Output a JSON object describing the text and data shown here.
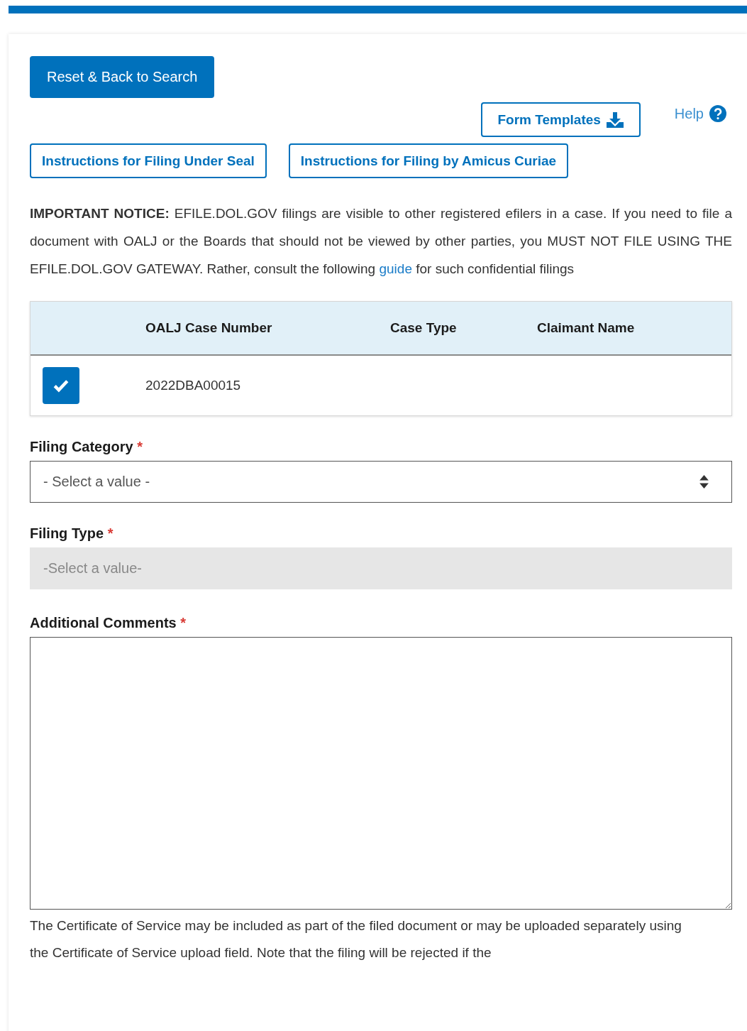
{
  "header_buttons": {
    "reset": "Reset & Back to Search",
    "form_templates": "Form Templates",
    "help": "Help"
  },
  "instruction_buttons": [
    "Instructions for Filing Under Seal",
    "Instructions for Filing by Amicus Curiae"
  ],
  "notice": {
    "label": "IMPORTANT NOTICE:",
    "text_before": "EFILE.DOL.GOV filings are visible to other registered efilers in a case. If you need to file a document with OALJ or the Boards that should not be viewed by other parties, you MUST NOT FILE USING THE EFILE.DOL.GOV GATEWAY. Rather, consult the following",
    "link": "guide",
    "text_after": "for such confidential filings"
  },
  "table": {
    "columns": [
      "OALJ Case Number",
      "Case Type",
      "Claimant Name"
    ],
    "rows": [
      {
        "checked": true,
        "case_number": "2022DBA00015"
      }
    ]
  },
  "fields": [
    {
      "kind": "select",
      "label": "Filing Category",
      "required_mark": "*",
      "placeholder": "- Select a value -",
      "disabled": false
    },
    {
      "kind": "select",
      "label": "Filing Type",
      "required_mark": "*",
      "placeholder": "-Select a value-",
      "disabled": true
    },
    {
      "kind": "textarea",
      "label": "Additional Comments",
      "required_mark": "*"
    }
  ],
  "footer_text": "The Certificate of Service may be included as part of the filed document or may be uploaded separately using the Certificate of Service upload field. Note that the filing will be rejected if the"
}
